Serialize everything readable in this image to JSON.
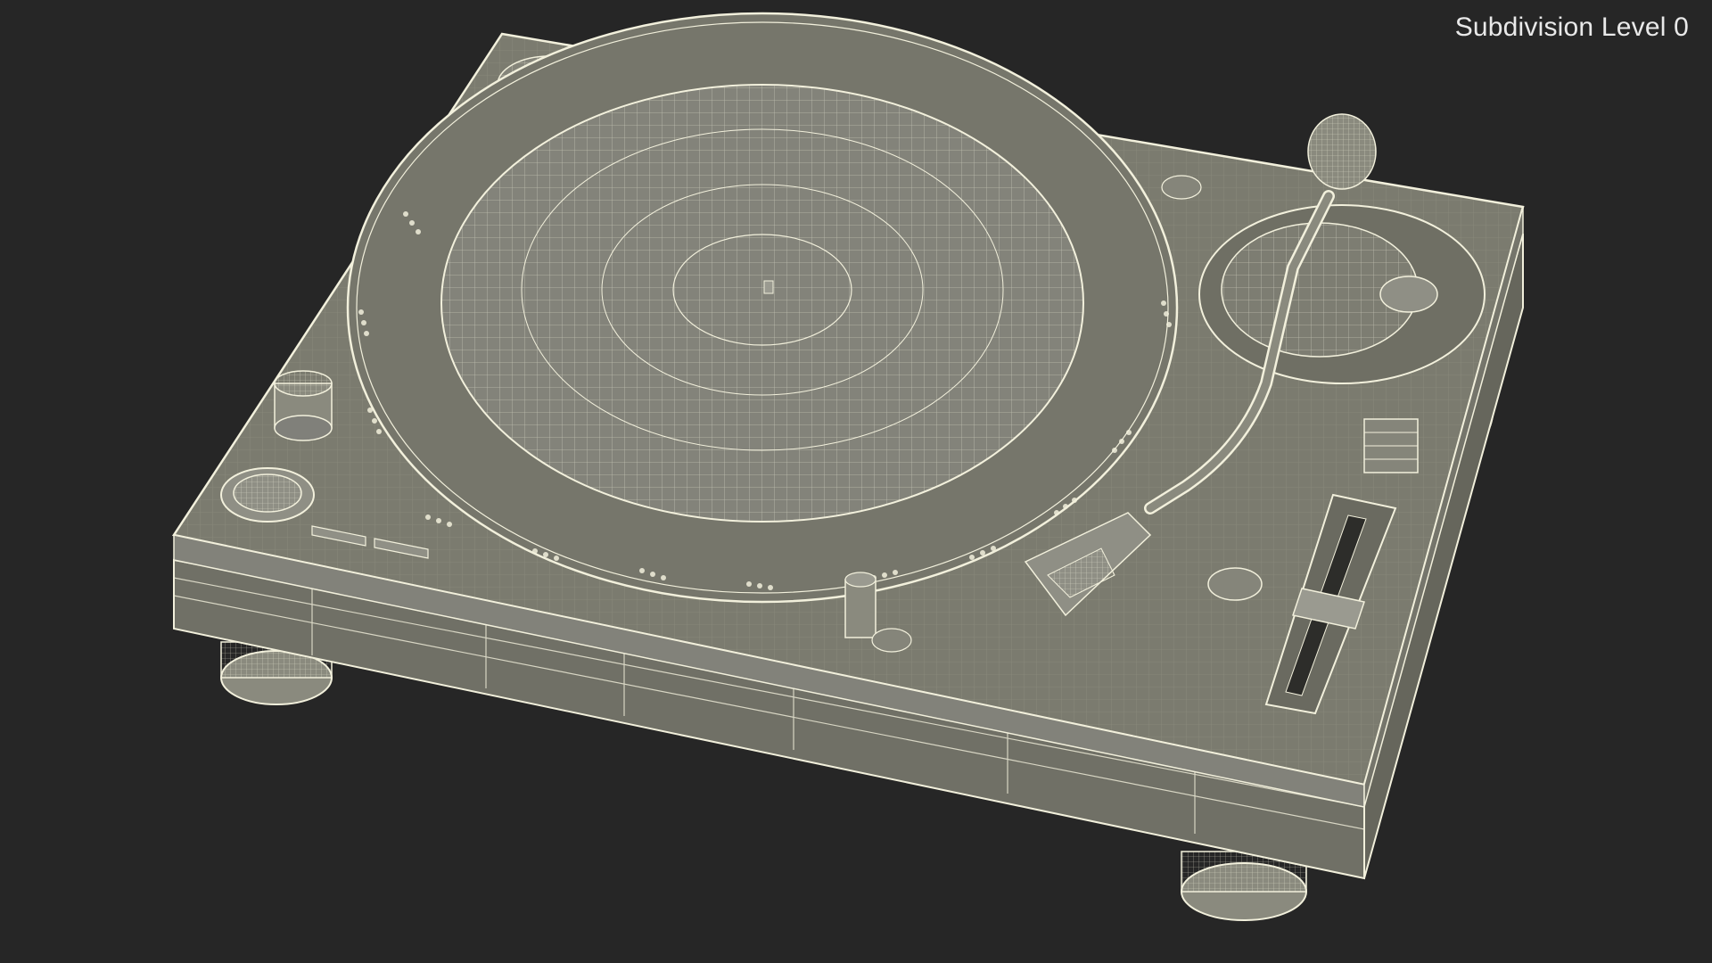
{
  "viewport": {
    "overlay_label": "Subdivision Level 0",
    "background_color": "#262626",
    "model_color": "#7b7b6f",
    "wire_color": "#f2f0dc"
  },
  "model": {
    "subject": "dj-turntable-wireframe",
    "parts": [
      "plinth",
      "platter",
      "tonearm",
      "headshell",
      "pitch-slider",
      "start-stop-button",
      "power-knob",
      "strobe-light",
      "feet"
    ]
  }
}
